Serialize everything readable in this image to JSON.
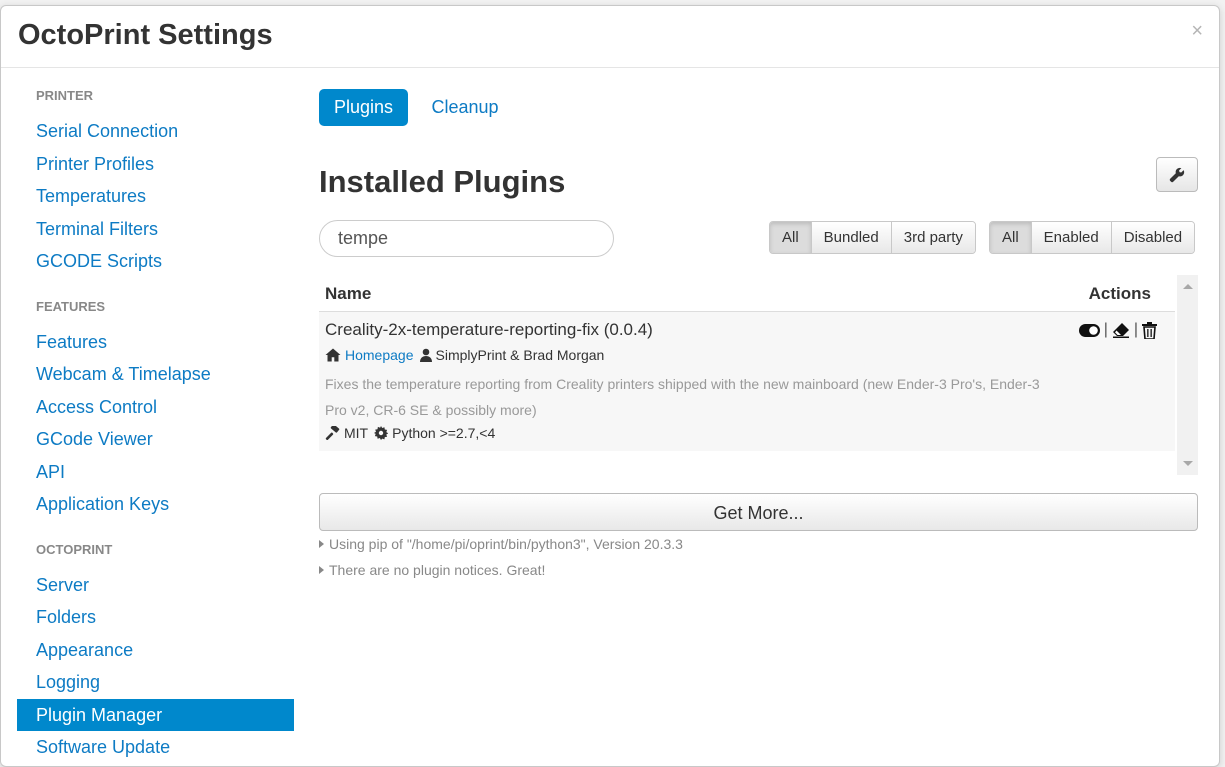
{
  "modal": {
    "title": "OctoPrint Settings",
    "close_label": "×"
  },
  "sidebar": {
    "sections": [
      {
        "heading": "PRINTER",
        "items": [
          "Serial Connection",
          "Printer Profiles",
          "Temperatures",
          "Terminal Filters",
          "GCODE Scripts"
        ]
      },
      {
        "heading": "FEATURES",
        "items": [
          "Features",
          "Webcam & Timelapse",
          "Access Control",
          "GCode Viewer",
          "API",
          "Application Keys"
        ]
      },
      {
        "heading": "OCTOPRINT",
        "items": [
          "Server",
          "Folders",
          "Appearance",
          "Logging",
          "Plugin Manager",
          "Software Update"
        ]
      }
    ],
    "active": "Plugin Manager"
  },
  "tabs": [
    "Plugins",
    "Cleanup"
  ],
  "active_tab": "Plugins",
  "installed_title": "Installed Plugins",
  "search": {
    "value": "tempe",
    "placeholder": ""
  },
  "filter_source": [
    "All",
    "Bundled",
    "3rd party"
  ],
  "filter_state": [
    "All",
    "Enabled",
    "Disabled"
  ],
  "table": {
    "col_name": "Name",
    "col_actions": "Actions",
    "plugins": [
      {
        "name": "Creality-2x-temperature-reporting-fix (0.0.4)",
        "homepage_label": "Homepage",
        "author": "SimplyPrint & Brad Morgan",
        "description": "Fixes the temperature reporting from Creality printers shipped with the new mainboard (new Ender-3 Pro's, Ender-3 Pro v2, CR-6 SE & possibly more)",
        "license": "MIT",
        "python": "Python >=2.7,<4",
        "separator": "|"
      }
    ]
  },
  "get_more_label": "Get More...",
  "notes": [
    "Using pip of \"/home/pi/oprint/bin/python3\", Version 20.3.3",
    "There are no plugin notices. Great!"
  ],
  "colors": {
    "accent": "#0088cc",
    "link": "#0d7bc4"
  }
}
